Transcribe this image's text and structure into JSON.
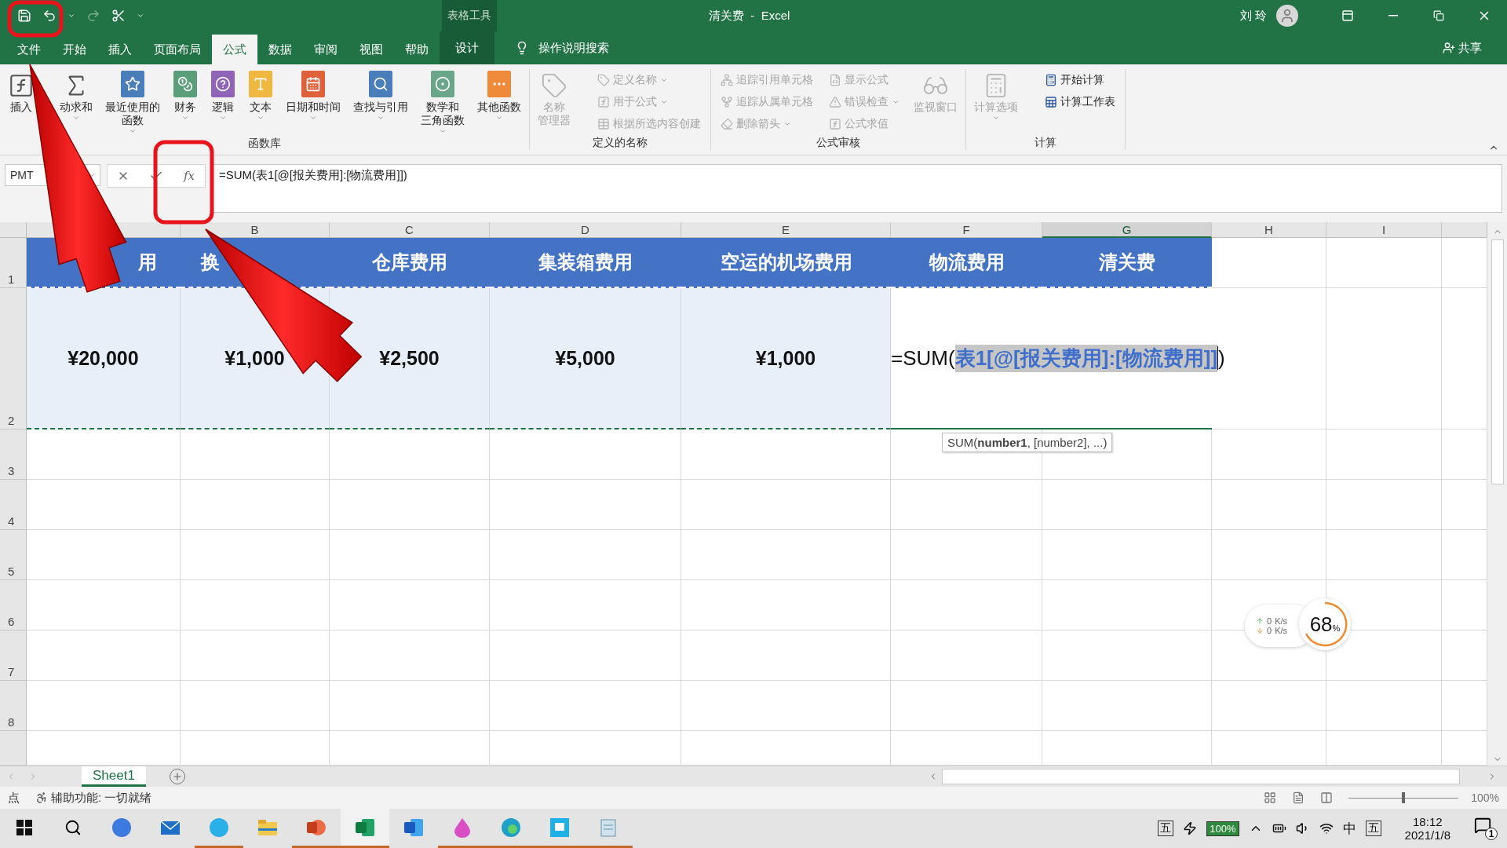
{
  "title_bar": {
    "context_label": "表格工具",
    "title": "清关费  -  Excel",
    "user": "刘 玲"
  },
  "menu_tabs": [
    {
      "label": "文件",
      "selected": false,
      "kind": "plain"
    },
    {
      "label": "开始",
      "selected": false,
      "kind": "plain"
    },
    {
      "label": "插入",
      "selected": false,
      "kind": "plain"
    },
    {
      "label": "页面布局",
      "selected": false,
      "kind": "plain"
    },
    {
      "label": "公式",
      "selected": true,
      "kind": "plain"
    },
    {
      "label": "数据",
      "selected": false,
      "kind": "plain"
    },
    {
      "label": "审阅",
      "selected": false,
      "kind": "plain"
    },
    {
      "label": "视图",
      "selected": false,
      "kind": "plain"
    },
    {
      "label": "帮助",
      "selected": false,
      "kind": "plain"
    },
    {
      "label": "设计",
      "selected": false,
      "kind": "context"
    }
  ],
  "tell_me": "操作说明搜索",
  "share": "共享",
  "ribbon_groups": [
    {
      "label": "函数库",
      "items": [
        {
          "kind": "large",
          "lines": [
            "插入"
          ],
          "dropdown": false,
          "disabled": false
        },
        {
          "kind": "large",
          "lines": [
            "动求和"
          ],
          "dropdown": true,
          "disabled": false
        },
        {
          "kind": "large",
          "lines": [
            "最近使用的",
            "函数"
          ],
          "dropdown": true,
          "disabled": false
        },
        {
          "kind": "large",
          "lines": [
            "财务"
          ],
          "dropdown": true,
          "disabled": false
        },
        {
          "kind": "large",
          "lines": [
            "逻辑"
          ],
          "dropdown": true,
          "disabled": false
        },
        {
          "kind": "large",
          "lines": [
            "文本"
          ],
          "dropdown": true,
          "disabled": false
        },
        {
          "kind": "large",
          "lines": [
            "日期和时间"
          ],
          "dropdown": true,
          "disabled": false
        },
        {
          "kind": "large",
          "lines": [
            "查找与引用"
          ],
          "dropdown": true,
          "disabled": false
        },
        {
          "kind": "large",
          "lines": [
            "数学和",
            "三角函数"
          ],
          "dropdown": true,
          "disabled": false
        },
        {
          "kind": "large",
          "lines": [
            "其他函数"
          ],
          "dropdown": true,
          "disabled": false
        }
      ]
    },
    {
      "label": "定义的名称",
      "items": [
        {
          "kind": "large",
          "lines": [
            "名称",
            "管理器"
          ],
          "dropdown": false,
          "disabled": true
        },
        {
          "kind": "stack",
          "items": [
            {
              "label": "定义名称",
              "dropdown": true,
              "disabled": true
            },
            {
              "label": "用于公式",
              "dropdown": true,
              "disabled": true
            },
            {
              "label": "根据所选内容创建",
              "dropdown": false,
              "disabled": true
            }
          ]
        }
      ]
    },
    {
      "label": "公式审核",
      "items": [
        {
          "kind": "stack",
          "items": [
            {
              "label": "追踪引用单元格",
              "dropdown": false,
              "disabled": true
            },
            {
              "label": "追踪从属单元格",
              "dropdown": false,
              "disabled": true
            },
            {
              "label": "删除箭头",
              "dropdown": true,
              "disabled": true
            }
          ]
        },
        {
          "kind": "stack",
          "items": [
            {
              "label": "显示公式",
              "dropdown": false,
              "disabled": true
            },
            {
              "label": "错误检查",
              "dropdown": true,
              "disabled": true
            },
            {
              "label": "公式求值",
              "dropdown": false,
              "disabled": true
            }
          ]
        },
        {
          "kind": "large",
          "lines": [
            "监视窗口"
          ],
          "dropdown": false,
          "disabled": true
        }
      ]
    },
    {
      "label": "计算",
      "items": [
        {
          "kind": "large",
          "lines": [
            "计算选项"
          ],
          "dropdown": true,
          "disabled": true
        },
        {
          "kind": "stack",
          "items": [
            {
              "label": "开始计算",
              "dropdown": false,
              "disabled": false
            },
            {
              "label": "计算工作表",
              "dropdown": false,
              "disabled": false
            }
          ]
        }
      ]
    }
  ],
  "formula_bar": {
    "name_box": "PMT",
    "fx": "fx",
    "formula": "=SUM(表1[@[报关费用]:[物流费用]])"
  },
  "columns": [
    {
      "label": "B",
      "selected": false
    },
    {
      "label": "C",
      "selected": false
    },
    {
      "label": "D",
      "selected": false
    },
    {
      "label": "E",
      "selected": false
    },
    {
      "label": "F",
      "selected": false
    },
    {
      "label": "G",
      "selected": true
    },
    {
      "label": "H",
      "selected": false
    },
    {
      "label": "I",
      "selected": false
    }
  ],
  "row_numbers": [
    "1",
    "2",
    "3",
    "4",
    "5",
    "6",
    "7",
    "8"
  ],
  "table": {
    "headers": [
      "用",
      "换",
      "仓库费用",
      "集装箱费用",
      "空运的机场费用",
      "物流费用",
      "清关费"
    ],
    "values": [
      "¥20,000",
      "¥1,000",
      "¥2,500",
      "¥5,000",
      "¥1,000"
    ],
    "editor": {
      "prefix": "=SUM(",
      "reference": "表1[@[报关费用]:[物流费用]]",
      "suffix": ")"
    },
    "tooltip": "SUM(**number1**, [number2], ...)"
  },
  "network_widget": {
    "up": "0",
    "up_unit": "K/s",
    "down": "0",
    "down_unit": "K/s",
    "cpu": "68",
    "cpu_unit": "%"
  },
  "sheet_tabs": [
    {
      "label": "Sheet1",
      "selected": true
    }
  ],
  "status_bar": {
    "mode": "点",
    "accessibility": "辅助功能: 一切就绪",
    "zoom": "100%",
    "zoom_slider": {
      "level": 0.5
    }
  },
  "taskbar": {
    "apps": [
      {
        "running": false,
        "active": false
      },
      {
        "running": false,
        "active": false
      },
      {
        "running": true,
        "active": false
      },
      {
        "running": false,
        "active": false
      },
      {
        "running": true,
        "active": false
      },
      {
        "running": true,
        "active": true
      },
      {
        "running": false,
        "active": false
      },
      {
        "running": true,
        "active": false
      },
      {
        "running": true,
        "active": false
      },
      {
        "running": true,
        "active": false
      },
      {
        "running": true,
        "active": false
      }
    ],
    "ime_left": "五",
    "battery": "100%",
    "ime_lang": "中",
    "ime_right": "五",
    "time": "18:12",
    "date": "2021/1/8",
    "notifications": "1"
  }
}
